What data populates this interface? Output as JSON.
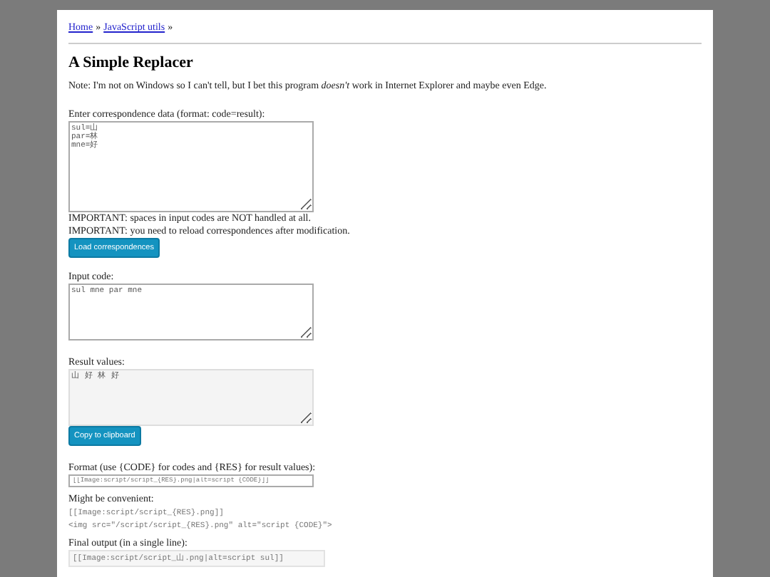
{
  "breadcrumb": [
    {
      "label": "Home"
    },
    {
      "label": "JavaScript utils"
    }
  ],
  "breadcrumb_separator": "»",
  "title": "A Simple Replacer",
  "note": "Note: I'm not on Windows so I can't tell, but I bet this program *doesn't* work in Internet Explorer and maybe even Edge.",
  "correspondence": {
    "label": "Enter correspondence data (format: code=result):",
    "value": "sul=山\npar=林\nmne=好"
  },
  "warnings": [
    "IMPORTANT: spaces in input codes are NOT handled at all.",
    "IMPORTANT: you need to reload correspondences after modification."
  ],
  "load_button": "Load correspondences",
  "input_code": {
    "label": "Input code:",
    "value": "sul mne par mne"
  },
  "result": {
    "label": "Result values:",
    "value": "山 好 林 好"
  },
  "copy_button": "Copy to clipboard",
  "format": {
    "label": "Format (use {CODE} for codes and {RES} for result values):",
    "value": "[[Image:script/script_{RES}.png|alt=script {CODE}]]"
  },
  "convenient": {
    "label": "Might be convenient:",
    "lines": [
      "[[Image:script/script_{RES}.png]]",
      "<img src=\"/script/script_{RES}.png\" alt=\"script {CODE}\">"
    ]
  },
  "final_output": {
    "label": "Final output (in a single line):",
    "lines": [
      "[[Image:script/script_山.png|alt=script sul]]"
    ]
  }
}
